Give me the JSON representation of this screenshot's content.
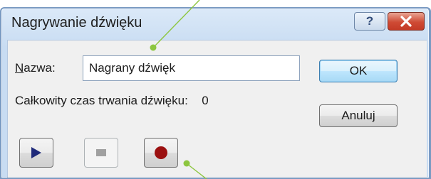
{
  "window": {
    "title": "Nagrywanie dźwięku"
  },
  "titlebar": {
    "help_glyph": "?",
    "help_icon": "question-mark-icon",
    "close_icon": "close-x-icon"
  },
  "form": {
    "name_label_accel": "N",
    "name_label_rest": "azwa:",
    "name_value": "Nagrany dźwięk",
    "duration_label": "Całkowity czas trwania dźwięku:",
    "duration_value": "0"
  },
  "buttons": {
    "ok_label": "OK",
    "cancel_label": "Anuluj"
  },
  "media": {
    "play_icon": "play-icon",
    "stop_icon": "stop-icon",
    "record_icon": "record-icon"
  },
  "colors": {
    "accent_arrow": "#8dc63f",
    "play_color": "#1f2a7a",
    "record_color": "#9b1010",
    "stop_color": "#a0a0a0",
    "close_button": "#c43a26"
  }
}
